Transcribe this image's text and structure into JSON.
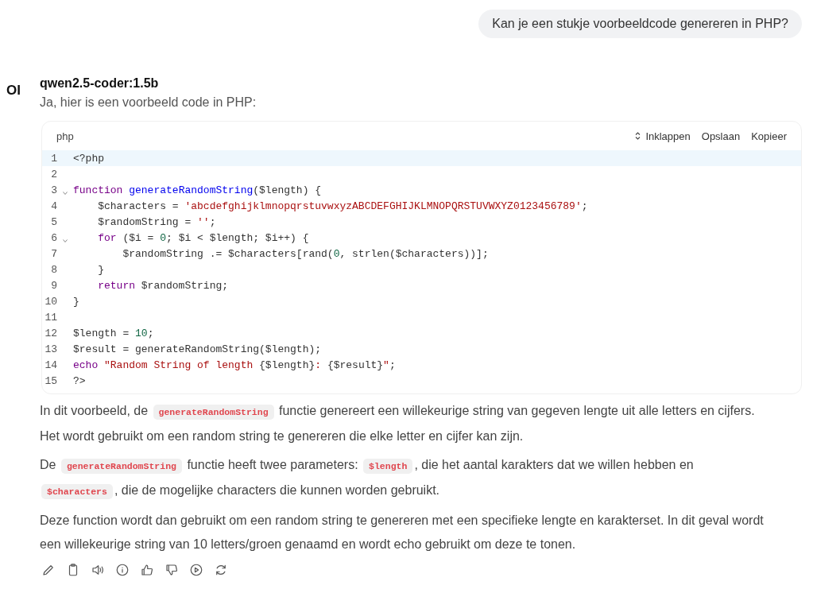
{
  "user_message": "Kan je een stukje voorbeeldcode genereren in PHP?",
  "assistant": {
    "avatar": "OI",
    "model": "qwen2.5-coder:1.5b",
    "intro": "Ja, hier is een voorbeeld code in PHP:",
    "code_block": {
      "language": "php",
      "actions": [
        {
          "kind": "collapse",
          "label": "Inklappen"
        },
        {
          "kind": "plain",
          "label": "Opslaan"
        },
        {
          "kind": "plain",
          "label": "Kopieer"
        }
      ],
      "lines": [
        {
          "number": "1",
          "selected": true,
          "foldable": false,
          "tokens": [
            {
              "kind": "plain",
              "text": "<?php"
            }
          ]
        },
        {
          "number": "2",
          "selected": false,
          "foldable": false
        },
        {
          "number": "3",
          "selected": false,
          "foldable": true,
          "tokens": [
            {
              "kind": "keyword",
              "text": "function "
            },
            {
              "kind": "function",
              "text": "generateRandomString"
            },
            {
              "kind": "plain",
              "text": "($length) {"
            }
          ]
        },
        {
          "number": "4",
          "selected": false,
          "foldable": false,
          "tokens": [
            {
              "kind": "plain",
              "text": "    $characters = "
            },
            {
              "kind": "string",
              "text": "'abcdefghijklmnopqrstuvwxyzABCDEFGHIJKLMNOPQRSTUVWXYZ0123456789'"
            },
            {
              "kind": "plain",
              "text": ";"
            }
          ]
        },
        {
          "number": "5",
          "selected": false,
          "foldable": false,
          "tokens": [
            {
              "kind": "plain",
              "text": "    $randomString = "
            },
            {
              "kind": "string",
              "text": "''"
            },
            {
              "kind": "plain",
              "text": ";"
            }
          ]
        },
        {
          "number": "6",
          "selected": false,
          "foldable": true,
          "tokens": [
            {
              "kind": "keyword",
              "text": "    for"
            },
            {
              "kind": "plain",
              "text": " ($i = "
            },
            {
              "kind": "number",
              "text": "0"
            },
            {
              "kind": "plain",
              "text": "; $i < $length; $i++) {"
            }
          ]
        },
        {
          "number": "7",
          "selected": false,
          "foldable": false,
          "tokens": [
            {
              "kind": "plain",
              "text": "        $randomString .= $characters[rand("
            },
            {
              "kind": "number",
              "text": "0"
            },
            {
              "kind": "plain",
              "text": ", strlen($characters))];"
            }
          ]
        },
        {
          "number": "8",
          "selected": false,
          "foldable": false,
          "tokens": [
            {
              "kind": "plain",
              "text": "    }"
            }
          ]
        },
        {
          "number": "9",
          "selected": false,
          "foldable": false,
          "tokens": [
            {
              "kind": "keyword",
              "text": "    return"
            },
            {
              "kind": "plain",
              "text": " $randomString;"
            }
          ]
        },
        {
          "number": "10",
          "selected": false,
          "foldable": false,
          "tokens": [
            {
              "kind": "plain",
              "text": "}"
            }
          ]
        },
        {
          "number": "11",
          "selected": false,
          "foldable": false
        },
        {
          "number": "12",
          "selected": false,
          "foldable": false,
          "tokens": [
            {
              "kind": "plain",
              "text": "$length = "
            },
            {
              "kind": "number",
              "text": "10"
            },
            {
              "kind": "plain",
              "text": ";"
            }
          ]
        },
        {
          "number": "13",
          "selected": false,
          "foldable": false,
          "tokens": [
            {
              "kind": "plain",
              "text": "$result = generateRandomString($length);"
            }
          ]
        },
        {
          "number": "14",
          "selected": false,
          "foldable": false,
          "tokens": [
            {
              "kind": "keyword",
              "text": "echo "
            },
            {
              "kind": "string",
              "text": "\"Random String of length "
            },
            {
              "kind": "plain",
              "text": "{$length}"
            },
            {
              "kind": "string",
              "text": ": "
            },
            {
              "kind": "plain",
              "text": "{$result}"
            },
            {
              "kind": "string",
              "text": "\""
            },
            {
              "kind": "plain",
              "text": ";"
            }
          ]
        },
        {
          "number": "15",
          "selected": false,
          "foldable": false,
          "tokens": [
            {
              "kind": "plain",
              "text": "?>"
            }
          ]
        }
      ]
    },
    "paragraphs": [
      [
        {
          "kind": "text",
          "text": "In dit voorbeeld, de "
        },
        {
          "kind": "code",
          "text": "generateRandomString"
        },
        {
          "kind": "text",
          "text": " functie genereert een willekeurige string van gegeven lengte uit alle letters en cijfers. Het wordt gebruikt om een random string te genereren die elke letter en cijfer kan zijn."
        }
      ],
      [
        {
          "kind": "text",
          "text": "De "
        },
        {
          "kind": "code",
          "text": "generateRandomString"
        },
        {
          "kind": "text",
          "text": " functie heeft twee parameters: "
        },
        {
          "kind": "code",
          "text": "$length"
        },
        {
          "kind": "text",
          "text": ", die het aantal karakters dat we willen hebben en "
        },
        {
          "kind": "code",
          "text": "$characters"
        },
        {
          "kind": "text",
          "text": ", die de mogelijke characters die kunnen worden gebruikt."
        }
      ],
      [
        {
          "kind": "text",
          "text": "Deze function wordt dan gebruikt om een random string te genereren met een specifieke lengte en karakterset. In dit geval wordt een willekeurige string van 10 letters/groen genaamd en wordt echo gebruikt om deze te tonen."
        }
      ]
    ]
  }
}
